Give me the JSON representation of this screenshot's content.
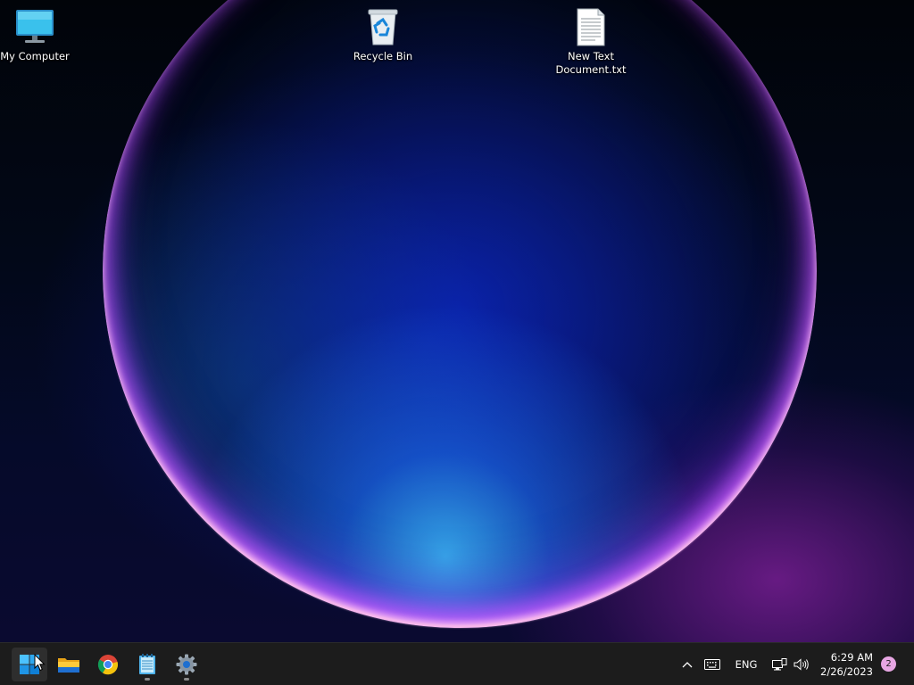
{
  "desktop": {
    "icons": [
      {
        "label": "My Computer",
        "icon": "monitor-icon"
      },
      {
        "label": "Recycle Bin",
        "icon": "recycle-bin-icon"
      },
      {
        "label": "New Text\nDocument.txt",
        "icon": "text-document-icon"
      }
    ]
  },
  "taskbar": {
    "apps": [
      {
        "name": "Start",
        "icon": "windows-start-icon",
        "active": true
      },
      {
        "name": "File Explorer",
        "icon": "folder-icon"
      },
      {
        "name": "Google Chrome",
        "icon": "chrome-icon"
      },
      {
        "name": "Notepad",
        "icon": "notepad-icon",
        "running": true
      },
      {
        "name": "Settings",
        "icon": "gear-icon",
        "running": true
      }
    ],
    "tray": {
      "chevron": "chevron-up-icon",
      "keyboard": "keyboard-icon",
      "language": "ENG",
      "network": "network-icon",
      "volume": "speaker-icon"
    },
    "clock": {
      "time": "6:29 AM",
      "date": "2/26/2023"
    },
    "notifications": "2"
  },
  "colors": {
    "taskbar_bg": "#1c1c1c",
    "accent": "#0078d4",
    "badge": "#e7a6e3"
  }
}
